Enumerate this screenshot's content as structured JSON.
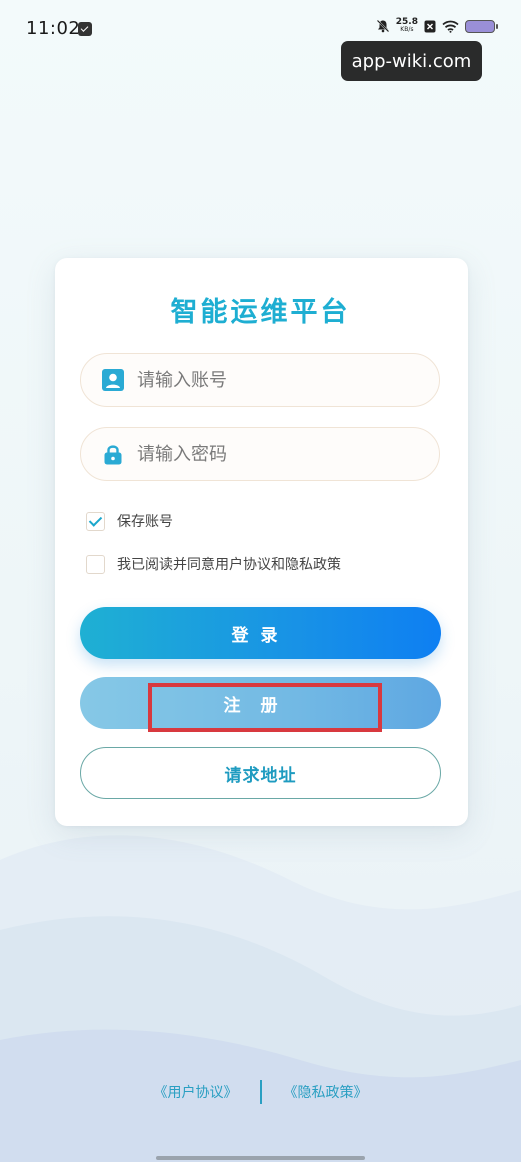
{
  "status_bar": {
    "time": "11:02",
    "net_speed": "25.8",
    "net_unit": "KB/s",
    "battery_color": "#9a8fd8"
  },
  "watermark": "app-wiki.com",
  "login": {
    "title": "智能运维平台",
    "account_placeholder": "请输入账号",
    "password_placeholder": "请输入密码",
    "save_account_label": "保存账号",
    "save_account_checked": true,
    "agreement_label": "我已阅读并同意用户协议和隐私政策",
    "agreement_checked": false,
    "login_button": "登录",
    "register_button": "注册",
    "request_address_button": "请求地址"
  },
  "footer": {
    "user_agreement": "《用户协议》",
    "privacy_policy": "《隐私政策》"
  },
  "colors": {
    "accent": "#1eaed2",
    "login_gradient_start": "#1fb0d3",
    "login_gradient_end": "#0e7ff2",
    "register_button": "#72b9e4",
    "highlight": "#d8393f"
  }
}
